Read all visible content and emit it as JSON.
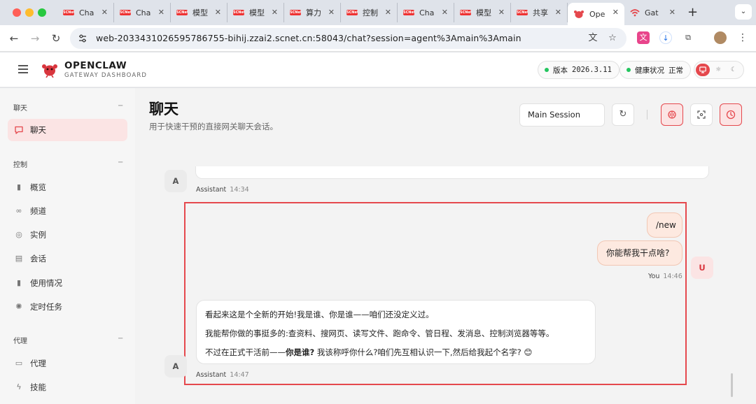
{
  "browser": {
    "tabs": [
      {
        "label": "Cha",
        "active": false
      },
      {
        "label": "Cha",
        "active": false
      },
      {
        "label": "模型",
        "active": false
      },
      {
        "label": "模型",
        "active": false
      },
      {
        "label": "算力",
        "active": false
      },
      {
        "label": "控制",
        "active": false
      },
      {
        "label": "Cha",
        "active": false
      },
      {
        "label": "模型",
        "active": false
      },
      {
        "label": "共享",
        "active": false
      },
      {
        "label": "Ope",
        "active": true
      },
      {
        "label": "Gat",
        "active": false
      }
    ],
    "favicon_text": "SCNet",
    "url": "web-2033431026595786755-bihij.zzai2.scnet.cn:58043/chat?session=agent%3Amain%3Amain"
  },
  "header": {
    "brand_title": "OPENCLAW",
    "brand_subtitle": "GATEWAY DASHBOARD",
    "version_label": "版本",
    "version_value": "2026.3.11",
    "health_label": "健康状况",
    "health_value": "正常"
  },
  "sidebar": {
    "sections": [
      {
        "title": "聊天",
        "items": [
          {
            "label": "聊天",
            "icon": "chat-icon",
            "active": true
          }
        ]
      },
      {
        "title": "控制",
        "items": [
          {
            "label": "概览",
            "icon": "bar-chart-icon"
          },
          {
            "label": "频道",
            "icon": "link-icon"
          },
          {
            "label": "实例",
            "icon": "broadcast-icon"
          },
          {
            "label": "会话",
            "icon": "document-icon"
          },
          {
            "label": "使用情况",
            "icon": "bar-chart-icon"
          },
          {
            "label": "定时任务",
            "icon": "loader-icon"
          }
        ]
      },
      {
        "title": "代理",
        "items": [
          {
            "label": "代理",
            "icon": "folder-icon"
          },
          {
            "label": "技能",
            "icon": "lightning-icon"
          }
        ]
      }
    ],
    "collapse_glyph": "−"
  },
  "main": {
    "title": "聊天",
    "subtitle": "用于快速干预的直接网关聊天会话。",
    "session_select": "Main Session"
  },
  "messages": {
    "assistant_avatar": "A",
    "user_avatar": "U",
    "prev_sender": "Assistant",
    "prev_time": "14:34",
    "user_bubbles": [
      "/new",
      "你能帮我干点啥?"
    ],
    "user_sender": "You",
    "user_time": "14:46",
    "assistant_lines": [
      "看起来这是个全新的开始!我是谁、你是谁——咱们还没定义过。",
      "我能帮你做的事挺多的:查资料、搜网页、读写文件、跑命令、管日程、发消息、控制浏览器等等。"
    ],
    "assistant_line3_pre": "不过在正式干活前——",
    "assistant_line3_bold": "你是谁?",
    "assistant_line3_post": " 我该称呼你什么?咱们先互相认识一下,然后给我起个名字? 😊",
    "assistant_sender": "Assistant",
    "assistant_time": "14:47"
  },
  "colors": {
    "accent": "#e5484d",
    "accent_soft": "#fbe4e4",
    "health_dot": "#22c55e",
    "user_bubble": "#fde9e0"
  }
}
